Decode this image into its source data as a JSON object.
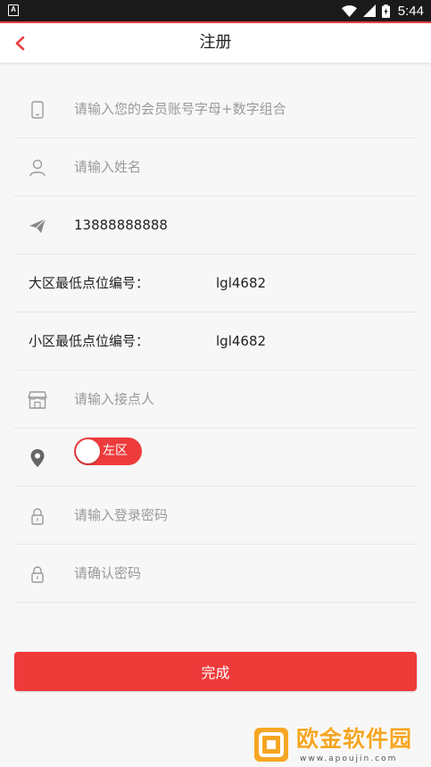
{
  "status_bar": {
    "left_icon": "A",
    "time": "5:44",
    "icons": [
      "wifi-icon",
      "signal-icon",
      "battery-icon"
    ]
  },
  "header": {
    "title": "注册",
    "back_icon": "chevron-left-icon"
  },
  "form": {
    "account": {
      "placeholder": "请输入您的会员账号字母+数字组合",
      "value": "",
      "icon": "phone-icon"
    },
    "name": {
      "placeholder": "请输入姓名",
      "value": "",
      "icon": "user-icon"
    },
    "phone": {
      "placeholder": "",
      "value": "13888888888",
      "icon": "send-icon"
    },
    "big_zone": {
      "label": "大区最低点位编号：",
      "value": "lgl4682"
    },
    "small_zone": {
      "label": "小区最低点位编号：",
      "value": "lgl4682"
    },
    "contact": {
      "placeholder": "请输入接点人",
      "value": "",
      "icon": "store-icon"
    },
    "zone_toggle": {
      "label": "左区",
      "icon": "location-icon"
    },
    "password": {
      "placeholder": "请输入登录密码",
      "value": "",
      "icon": "lock-icon"
    },
    "confirm_password": {
      "placeholder": "请确认密码",
      "value": "",
      "icon": "lock-icon"
    }
  },
  "submit": {
    "label": "完成"
  },
  "watermark": {
    "text": "欧金软件园",
    "url": "www.apoujin.com"
  },
  "colors": {
    "accent": "#ef3a3a",
    "back_arrow": "#e84040",
    "watermark": "#f5a623"
  }
}
